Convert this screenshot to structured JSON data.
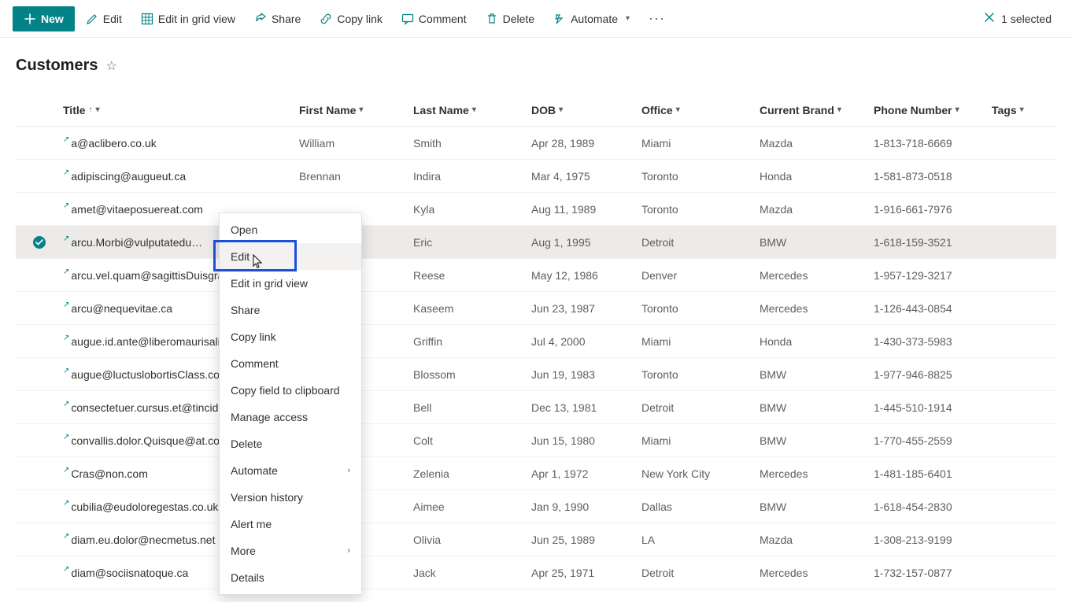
{
  "commandBar": {
    "new": "New",
    "edit": "Edit",
    "editGrid": "Edit in grid view",
    "share": "Share",
    "copyLink": "Copy link",
    "comment": "Comment",
    "delete": "Delete",
    "automate": "Automate",
    "selectedCount": "1 selected"
  },
  "page": {
    "title": "Customers"
  },
  "columns": {
    "title": "Title",
    "firstName": "First Name",
    "lastName": "Last Name",
    "dob": "DOB",
    "office": "Office",
    "currentBrand": "Current Brand",
    "phone": "Phone Number",
    "tags": "Tags"
  },
  "rows": [
    {
      "title": "a@aclibero.co.uk",
      "firstName": "William",
      "lastName": "Smith",
      "dob": "Apr 28, 1989",
      "office": "Miami",
      "brand": "Mazda",
      "phone": "1-813-718-6669"
    },
    {
      "title": "adipiscing@augueut.ca",
      "firstName": "Brennan",
      "lastName": "Indira",
      "dob": "Mar 4, 1975",
      "office": "Toronto",
      "brand": "Honda",
      "phone": "1-581-873-0518"
    },
    {
      "title": "amet@vitaeposuereat.com",
      "firstName": "",
      "lastName": "Kyla",
      "dob": "Aug 11, 1989",
      "office": "Toronto",
      "brand": "Mazda",
      "phone": "1-916-661-7976"
    },
    {
      "title": "arcu.Morbi@vulputatedu…",
      "firstName": "",
      "lastName": "Eric",
      "dob": "Aug 1, 1995",
      "office": "Detroit",
      "brand": "BMW",
      "phone": "1-618-159-3521",
      "selected": true
    },
    {
      "title": "arcu.vel.quam@sagittisDuisgravid",
      "firstName": "",
      "lastName": "Reese",
      "dob": "May 12, 1986",
      "office": "Denver",
      "brand": "Mercedes",
      "phone": "1-957-129-3217"
    },
    {
      "title": "arcu@nequevitae.ca",
      "firstName": "",
      "lastName": "Kaseem",
      "dob": "Jun 23, 1987",
      "office": "Toronto",
      "brand": "Mercedes",
      "phone": "1-126-443-0854"
    },
    {
      "title": "augue.id.ante@liberomaurisaliqua",
      "firstName": "",
      "lastName": "Griffin",
      "dob": "Jul 4, 2000",
      "office": "Miami",
      "brand": "Honda",
      "phone": "1-430-373-5983"
    },
    {
      "title": "augue@luctuslobortisClass.co.uk",
      "firstName": "",
      "lastName": "Blossom",
      "dob": "Jun 19, 1983",
      "office": "Toronto",
      "brand": "BMW",
      "phone": "1-977-946-8825"
    },
    {
      "title": "consectetuer.cursus.et@tincidunt[",
      "firstName": "",
      "lastName": "Bell",
      "dob": "Dec 13, 1981",
      "office": "Detroit",
      "brand": "BMW",
      "phone": "1-445-510-1914"
    },
    {
      "title": "convallis.dolor.Quisque@at.co.uk",
      "firstName": "",
      "lastName": "Colt",
      "dob": "Jun 15, 1980",
      "office": "Miami",
      "brand": "BMW",
      "phone": "1-770-455-2559"
    },
    {
      "title": "Cras@non.com",
      "firstName": "",
      "lastName": "Zelenia",
      "dob": "Apr 1, 1972",
      "office": "New York City",
      "brand": "Mercedes",
      "phone": "1-481-185-6401"
    },
    {
      "title": "cubilia@eudoloregestas.co.uk",
      "firstName": "",
      "lastName": "Aimee",
      "dob": "Jan 9, 1990",
      "office": "Dallas",
      "brand": "BMW",
      "phone": "1-618-454-2830"
    },
    {
      "title": "diam.eu.dolor@necmetus.net",
      "firstName": "",
      "lastName": "Olivia",
      "dob": "Jun 25, 1989",
      "office": "LA",
      "brand": "Mazda",
      "phone": "1-308-213-9199"
    },
    {
      "title": "diam@sociisnatoque.ca",
      "firstName": "",
      "lastName": "Jack",
      "dob": "Apr 25, 1971",
      "office": "Detroit",
      "brand": "Mercedes",
      "phone": "1-732-157-0877"
    }
  ],
  "contextMenu": {
    "open": "Open",
    "edit": "Edit",
    "editGrid": "Edit in grid view",
    "share": "Share",
    "copyLink": "Copy link",
    "comment": "Comment",
    "copyField": "Copy field to clipboard",
    "manageAccess": "Manage access",
    "delete": "Delete",
    "automate": "Automate",
    "versionHistory": "Version history",
    "alertMe": "Alert me",
    "more": "More",
    "details": "Details"
  }
}
